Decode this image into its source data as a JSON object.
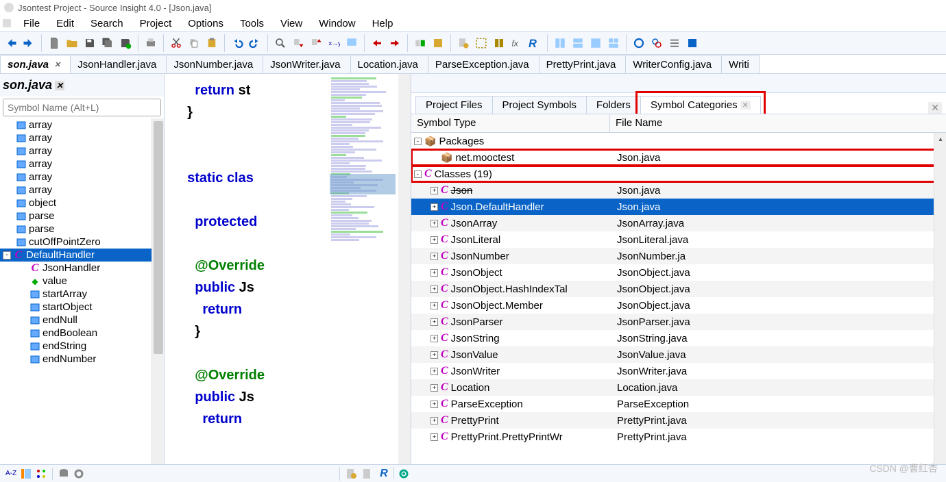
{
  "title": "Jsontest Project - Source Insight 4.0 - [Json.java]",
  "menu": [
    "File",
    "Edit",
    "Search",
    "Project",
    "Options",
    "Tools",
    "View",
    "Window",
    "Help"
  ],
  "fileTabs": [
    {
      "label": "son.java",
      "active": true,
      "close": true
    },
    {
      "label": "JsonHandler.java"
    },
    {
      "label": "JsonNumber.java"
    },
    {
      "label": "JsonWriter.java"
    },
    {
      "label": "Location.java"
    },
    {
      "label": "ParseException.java"
    },
    {
      "label": "PrettyPrint.java"
    },
    {
      "label": "WriterConfig.java"
    },
    {
      "label": "Writi"
    }
  ],
  "leftPanel": {
    "title": "son.java",
    "searchPlaceholder": "Symbol Name (Alt+L)",
    "items": [
      {
        "txt": "array",
        "icon": "m",
        "ind": 1,
        "exp": null
      },
      {
        "txt": "array",
        "icon": "m",
        "ind": 1,
        "exp": null
      },
      {
        "txt": "array",
        "icon": "m",
        "ind": 1,
        "exp": null
      },
      {
        "txt": "array",
        "icon": "m",
        "ind": 1,
        "exp": null
      },
      {
        "txt": "array",
        "icon": "m",
        "ind": 1,
        "exp": null
      },
      {
        "txt": "array",
        "icon": "m",
        "ind": 1,
        "exp": null
      },
      {
        "txt": "object",
        "icon": "m",
        "ind": 1,
        "exp": null
      },
      {
        "txt": "parse",
        "icon": "m",
        "ind": 1,
        "exp": null
      },
      {
        "txt": "parse",
        "icon": "m",
        "ind": 1,
        "exp": null
      },
      {
        "txt": "cutOffPointZero",
        "icon": "m",
        "ind": 1,
        "exp": null
      },
      {
        "txt": "DefaultHandler",
        "icon": "c",
        "ind": 0,
        "exp": "-",
        "sel": true
      },
      {
        "txt": "JsonHandler",
        "icon": "c",
        "ind": 2,
        "exp": null
      },
      {
        "txt": "value",
        "icon": "d",
        "ind": 2,
        "exp": null
      },
      {
        "txt": "startArray",
        "icon": "m",
        "ind": 2,
        "exp": null
      },
      {
        "txt": "startObject",
        "icon": "m",
        "ind": 2,
        "exp": null
      },
      {
        "txt": "endNull",
        "icon": "m",
        "ind": 2,
        "exp": null
      },
      {
        "txt": "endBoolean",
        "icon": "m",
        "ind": 2,
        "exp": null
      },
      {
        "txt": "endString",
        "icon": "m",
        "ind": 2,
        "exp": null
      },
      {
        "txt": "endNumber",
        "icon": "m",
        "ind": 2,
        "exp": null
      }
    ]
  },
  "code": [
    [
      {
        "t": "    ",
        "c": ""
      },
      {
        "t": "return",
        "c": "kw-blue"
      },
      {
        "t": " st",
        "c": "kw-black"
      }
    ],
    [
      {
        "t": "  }",
        "c": "kw-black"
      }
    ],
    [
      {
        "t": "",
        "c": ""
      }
    ],
    [
      {
        "t": "",
        "c": ""
      }
    ],
    [
      {
        "t": "  ",
        "c": ""
      },
      {
        "t": "static",
        "c": "kw-blue"
      },
      {
        "t": " ",
        "c": ""
      },
      {
        "t": "clas",
        "c": "kw-blue"
      }
    ],
    [
      {
        "t": "",
        "c": ""
      }
    ],
    [
      {
        "t": "    ",
        "c": ""
      },
      {
        "t": "protected",
        "c": "kw-blue"
      }
    ],
    [
      {
        "t": "",
        "c": ""
      }
    ],
    [
      {
        "t": "    ",
        "c": ""
      },
      {
        "t": "@Override",
        "c": "kw-green"
      }
    ],
    [
      {
        "t": "    ",
        "c": ""
      },
      {
        "t": "public",
        "c": "kw-blue"
      },
      {
        "t": " Js",
        "c": "kw-black"
      }
    ],
    [
      {
        "t": "      ",
        "c": ""
      },
      {
        "t": "return",
        "c": "kw-blue"
      }
    ],
    [
      {
        "t": "    }",
        "c": "kw-black"
      }
    ],
    [
      {
        "t": "",
        "c": ""
      }
    ],
    [
      {
        "t": "    ",
        "c": ""
      },
      {
        "t": "@Override",
        "c": "kw-green"
      }
    ],
    [
      {
        "t": "    ",
        "c": ""
      },
      {
        "t": "public",
        "c": "kw-blue"
      },
      {
        "t": " Js",
        "c": "kw-black"
      }
    ],
    [
      {
        "t": "      ",
        "c": ""
      },
      {
        "t": "return",
        "c": "kw-blue"
      }
    ]
  ],
  "rightPanel": {
    "tabs": [
      {
        "label": "Project Files"
      },
      {
        "label": "Project Symbols"
      },
      {
        "label": "Folders"
      },
      {
        "label": "Symbol Categories",
        "active": true,
        "close": true,
        "boxed": true
      }
    ],
    "cols": [
      "Symbol Type",
      "File Name"
    ],
    "rows": [
      {
        "pad": 4,
        "exp": "-",
        "icon": "pkg",
        "c1": "Packages",
        "c2": ""
      },
      {
        "pad": 28,
        "exp": " ",
        "icon": "pkg",
        "c1": "net.mooctest",
        "c2": "Json.java",
        "boxed": true
      },
      {
        "pad": 4,
        "exp": "-",
        "icon": "c",
        "c1": "Classes (19)",
        "c2": "",
        "boxed": true
      },
      {
        "pad": 28,
        "exp": "+",
        "icon": "c",
        "c1": "Json",
        "c2": "Json.java",
        "alt": true,
        "strike": true
      },
      {
        "pad": 28,
        "exp": "+",
        "icon": "c",
        "c1": "Json.DefaultHandler",
        "c2": "Json.java",
        "sel": true
      },
      {
        "pad": 28,
        "exp": "+",
        "icon": "c",
        "c1": "JsonArray",
        "c2": "JsonArray.java",
        "alt": true
      },
      {
        "pad": 28,
        "exp": "+",
        "icon": "c",
        "c1": "JsonLiteral",
        "c2": "JsonLiteral.java"
      },
      {
        "pad": 28,
        "exp": "+",
        "icon": "c",
        "c1": "JsonNumber",
        "c2": "JsonNumber.ja",
        "alt": true
      },
      {
        "pad": 28,
        "exp": "+",
        "icon": "c",
        "c1": "JsonObject",
        "c2": "JsonObject.java"
      },
      {
        "pad": 28,
        "exp": "+",
        "icon": "c",
        "c1": "JsonObject.HashIndexTal",
        "c2": "JsonObject.java",
        "alt": true
      },
      {
        "pad": 28,
        "exp": "+",
        "icon": "c",
        "c1": "JsonObject.Member",
        "c2": "JsonObject.java"
      },
      {
        "pad": 28,
        "exp": "+",
        "icon": "c",
        "c1": "JsonParser",
        "c2": "JsonParser.java",
        "alt": true
      },
      {
        "pad": 28,
        "exp": "+",
        "icon": "c",
        "c1": "JsonString",
        "c2": "JsonString.java"
      },
      {
        "pad": 28,
        "exp": "+",
        "icon": "c",
        "c1": "JsonValue",
        "c2": "JsonValue.java",
        "alt": true
      },
      {
        "pad": 28,
        "exp": "+",
        "icon": "c",
        "c1": "JsonWriter",
        "c2": "JsonWriter.java"
      },
      {
        "pad": 28,
        "exp": "+",
        "icon": "c",
        "c1": "Location",
        "c2": "Location.java",
        "alt": true
      },
      {
        "pad": 28,
        "exp": "+",
        "icon": "c",
        "c1": "ParseException",
        "c2": "ParseException"
      },
      {
        "pad": 28,
        "exp": "+",
        "icon": "c",
        "c1": "PrettyPrint",
        "c2": "PrettyPrint.java",
        "alt": true
      },
      {
        "pad": 28,
        "exp": "+",
        "icon": "c",
        "c1": "PrettyPrint.PrettyPrintWr",
        "c2": "PrettyPrint.java"
      }
    ]
  },
  "watermark": "CSDN @曹红杏"
}
